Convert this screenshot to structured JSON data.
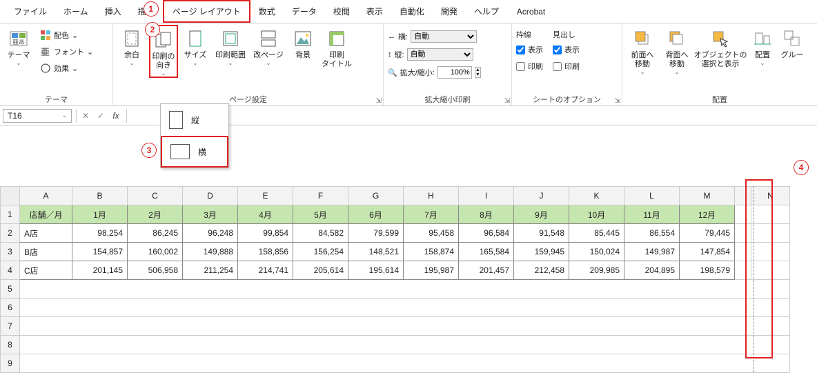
{
  "menubar": {
    "items": [
      "ファイル",
      "ホーム",
      "挿入",
      "描画",
      "ページ レイアウト",
      "数式",
      "データ",
      "校閲",
      "表示",
      "自動化",
      "開発",
      "ヘルプ",
      "Acrobat"
    ],
    "active_index": 4
  },
  "ribbon": {
    "theme": {
      "title": "テーマ",
      "theme_btn": "テーマ",
      "colors": "配色",
      "fonts": "フォント",
      "effects": "効果"
    },
    "page_setup": {
      "title": "ページ設定",
      "margins": "余白",
      "orientation": "印刷の\n向き",
      "size": "サイズ",
      "print_area": "印刷範囲",
      "breaks": "改ページ",
      "background": "背景",
      "print_titles": "印刷\nタイトル"
    },
    "scale": {
      "title": "拡大縮小印刷",
      "width_lbl": "横:",
      "height_lbl": "縦:",
      "scale_lbl": "拡大/縮小:",
      "width_val": "自動",
      "height_val": "自動",
      "scale_val": "100%"
    },
    "sheet_options": {
      "title": "シートのオプション",
      "gridlines_hdr": "枠線",
      "headings_hdr": "見出し",
      "view": "表示",
      "print": "印刷",
      "grid_view": true,
      "grid_print": false,
      "head_view": true,
      "head_print": false
    },
    "arrange": {
      "title": "配置",
      "bring_forward": "前面へ\n移動",
      "send_backward": "背面へ\n移動",
      "selection_pane": "オブジェクトの\n選択と表示",
      "align": "配置",
      "group": "グルー"
    }
  },
  "orientation_menu": {
    "portrait": "縦",
    "landscape": "横"
  },
  "formula_bar": {
    "name_box": "T16",
    "fx": "fx"
  },
  "grid": {
    "col_letters": [
      "A",
      "B",
      "C",
      "D",
      "E",
      "F",
      "G",
      "H",
      "I",
      "J",
      "K",
      "L",
      "M",
      "",
      "N"
    ],
    "header_row": [
      "店舗／月",
      "1月",
      "2月",
      "3月",
      "4月",
      "5月",
      "6月",
      "7月",
      "8月",
      "9月",
      "10月",
      "11月",
      "12月"
    ],
    "rows": [
      {
        "label": "A店",
        "values": [
          "98,254",
          "86,245",
          "96,248",
          "99,854",
          "84,582",
          "79,599",
          "95,458",
          "96,584",
          "91,548",
          "85,445",
          "86,554",
          "79,445"
        ]
      },
      {
        "label": "B店",
        "values": [
          "154,857",
          "160,002",
          "149,888",
          "158,856",
          "156,254",
          "148,521",
          "158,874",
          "165,584",
          "159,945",
          "150,024",
          "149,987",
          "147,854"
        ]
      },
      {
        "label": "C店",
        "values": [
          "201,145",
          "506,958",
          "211,254",
          "214,741",
          "205,614",
          "195,614",
          "195,987",
          "201,457",
          "212,458",
          "209,985",
          "204,895",
          "198,579"
        ]
      }
    ],
    "empty_rows": [
      5,
      6,
      7,
      8,
      9
    ]
  },
  "annotations": {
    "a1": "1",
    "a2": "2",
    "a3": "3",
    "a4": "4"
  }
}
